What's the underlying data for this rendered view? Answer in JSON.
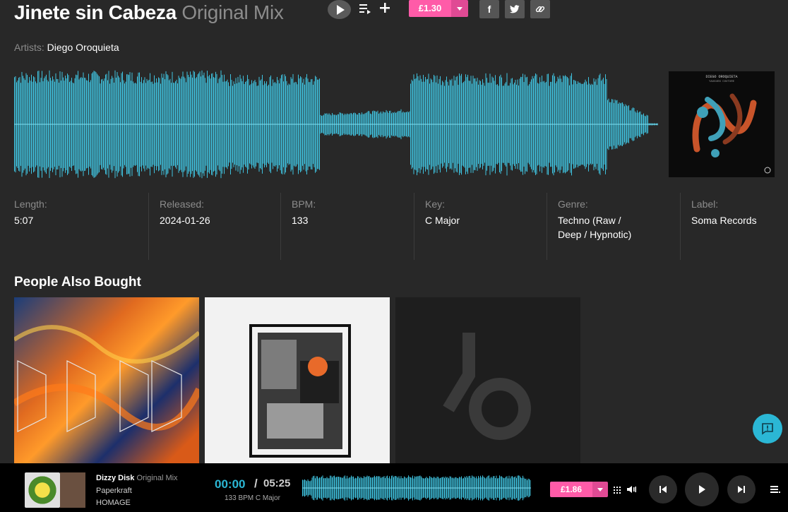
{
  "track": {
    "title": "Jinete sin Cabeza",
    "mix": "Original Mix",
    "artists_label": "Artists:",
    "artist": "Diego Oroquieta",
    "price": "£1.30"
  },
  "social": {
    "facebook": "f",
    "twitter": "t"
  },
  "cover": {
    "artist": "DIEGO OROQUIETA",
    "release": "YAUGUEN COUTURE"
  },
  "meta": [
    {
      "key": "Length:",
      "value": "5:07"
    },
    {
      "key": "Released:",
      "value": "2024-01-26"
    },
    {
      "key": "BPM:",
      "value": "133"
    },
    {
      "key": "Key:",
      "value": "C Major"
    },
    {
      "key": "Genre:",
      "value": "Techno (Raw / Deep / Hypnotic)"
    },
    {
      "key": "Label:",
      "value": "Soma Records"
    }
  ],
  "section": {
    "people_also_bought": "People Also Bought"
  },
  "player": {
    "title": "Dizzy Disk",
    "mix": "Original Mix",
    "artist": "Paperkraft",
    "label": "HOMAGE",
    "current_time": "00:00",
    "separator": "/",
    "total_time": "05:25",
    "info": "133 BPM C Major",
    "price": "£1.86"
  },
  "colors": {
    "accent": "#2bb7d5",
    "buy": "#ff5ba8",
    "background": "#282828"
  },
  "icons": [
    "play-icon",
    "add-to-queue-icon",
    "plus-icon",
    "dropdown-arrow-icon",
    "facebook-icon",
    "twitter-icon",
    "link-icon",
    "chat-icon",
    "grid-icon",
    "volume-icon",
    "previous-icon",
    "next-icon",
    "queue-icon"
  ]
}
